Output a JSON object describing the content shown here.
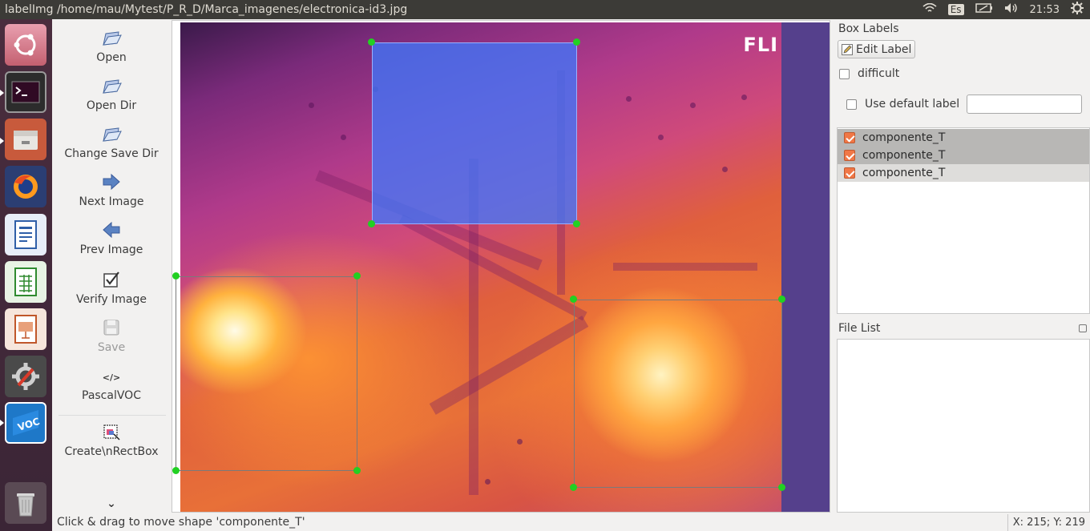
{
  "window": {
    "title": "labelImg /home/mau/Mytest/P_R_D/Marca_imagenes/electronica-id3.jpg"
  },
  "tray": {
    "keyboard_layout": "Es",
    "time": "21:53"
  },
  "launcher": [
    "ubuntu-dash",
    "terminal",
    "file-manager",
    "firefox",
    "libreoffice-writer",
    "libreoffice-calc",
    "libreoffice-impress",
    "system-settings",
    "labelimg-voc",
    "trash"
  ],
  "toolbar": {
    "open": "Open",
    "open_dir": "Open Dir",
    "change_save_dir": "Change Save Dir",
    "next_image": "Next Image",
    "prev_image": "Prev Image",
    "verify_image": "Verify Image",
    "save": "Save",
    "format": "PascalVOC",
    "format_icon": "</>",
    "create_rect": "Create\\nRectBox",
    "more": "⌄"
  },
  "image": {
    "logo_text": "FLI"
  },
  "box_labels": {
    "title": "Box Labels",
    "edit_label": "Edit Label",
    "difficult": "difficult",
    "use_default_label": "Use default label",
    "default_label_value": "",
    "items": [
      {
        "label": "componente_T",
        "checked": true
      },
      {
        "label": "componente_T",
        "checked": true
      },
      {
        "label": "componente_T",
        "checked": true
      }
    ]
  },
  "file_list": {
    "title": "File List",
    "items": []
  },
  "status": {
    "message": "Click & drag to move shape 'componente_T'",
    "coords": "X: 215; Y: 219"
  },
  "colors": {
    "accent": "#f07746",
    "handle": "#22d022",
    "selection": "#3c78ff"
  }
}
